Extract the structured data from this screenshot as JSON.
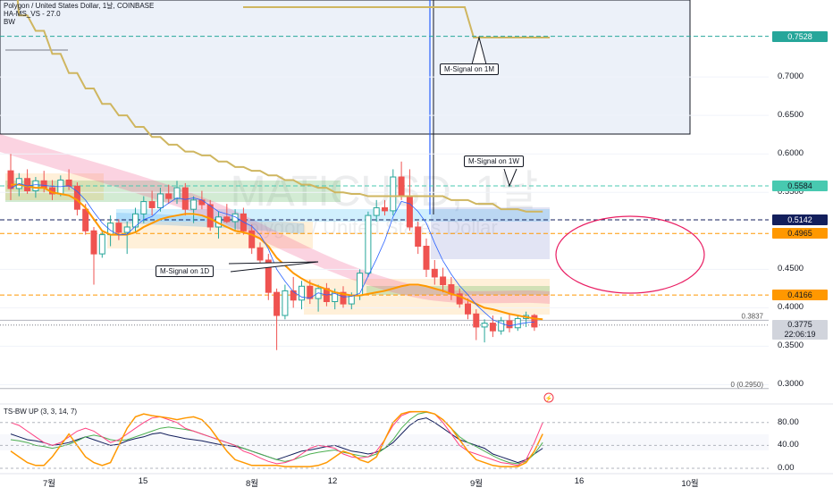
{
  "header": {
    "line1": "Polygon / United States Dollar, 1날, COINBASE",
    "line2": "HA-MS_VS - 27.0",
    "line3": "BW"
  },
  "watermark": {
    "symbol": "MATICUSD, 1날",
    "subtitle": "Polygon / United States Dollar"
  },
  "callouts": {
    "signal_1m": "M-Signal on 1M",
    "signal_1w": "M-Signal on 1W",
    "signal_1d": "M-Signal on 1D"
  },
  "oscillator": {
    "title": "TS-BW UP (3, 3, 14, 7)"
  },
  "chart_data": {
    "type": "candlestick",
    "price_axis": {
      "range": [
        0.275,
        0.8
      ],
      "ticks": [
        "0.7000",
        "0.6500",
        "0.6000",
        "0.5500",
        "0.4500",
        "0.4000",
        "0.3500",
        "0.3000"
      ]
    },
    "x_axis": {
      "labels": [
        "7월",
        "15",
        "8월",
        "12",
        "9월",
        "16",
        "10월"
      ]
    },
    "price_tags": [
      {
        "text": "0.7528",
        "value": 0.7528,
        "bg": "#26a69a",
        "fg": "#ffffff"
      },
      {
        "text": "0.5584",
        "value": 0.5584,
        "bg": "#48c9b0",
        "fg": "#131722"
      },
      {
        "text": "0.5142",
        "value": 0.5142,
        "bg": "#131f5c",
        "fg": "#ffffff"
      },
      {
        "text": "0.4965",
        "value": 0.4965,
        "bg": "#ff9800",
        "fg": "#131722"
      },
      {
        "text": "0.4166",
        "value": 0.4166,
        "bg": "#ff9800",
        "fg": "#131722"
      }
    ],
    "last_price": {
      "text": "0.3775",
      "countdown": "22:06:19",
      "value": 0.3775
    },
    "annotations": [
      {
        "text": "0.3837",
        "value": 0.3837
      },
      {
        "text": "0 (0.2950)",
        "value": 0.295
      }
    ],
    "oscillator_axis": {
      "ticks": [
        "80.00",
        "40.00",
        "0.00"
      ],
      "range": [
        0,
        100
      ]
    },
    "candles": [
      {
        "o": 0.578,
        "h": 0.6,
        "l": 0.54,
        "c": 0.555
      },
      {
        "o": 0.555,
        "h": 0.575,
        "l": 0.545,
        "c": 0.568
      },
      {
        "o": 0.568,
        "h": 0.58,
        "l": 0.548,
        "c": 0.552
      },
      {
        "o": 0.552,
        "h": 0.57,
        "l": 0.543,
        "c": 0.565
      },
      {
        "o": 0.565,
        "h": 0.578,
        "l": 0.55,
        "c": 0.556
      },
      {
        "o": 0.556,
        "h": 0.566,
        "l": 0.54,
        "c": 0.548
      },
      {
        "o": 0.548,
        "h": 0.572,
        "l": 0.545,
        "c": 0.566
      },
      {
        "o": 0.566,
        "h": 0.58,
        "l": 0.553,
        "c": 0.558
      },
      {
        "o": 0.558,
        "h": 0.563,
        "l": 0.52,
        "c": 0.528
      },
      {
        "o": 0.528,
        "h": 0.535,
        "l": 0.495,
        "c": 0.5
      },
      {
        "o": 0.5,
        "h": 0.505,
        "l": 0.43,
        "c": 0.47
      },
      {
        "o": 0.47,
        "h": 0.5,
        "l": 0.465,
        "c": 0.495
      },
      {
        "o": 0.495,
        "h": 0.52,
        "l": 0.48,
        "c": 0.51
      },
      {
        "o": 0.51,
        "h": 0.515,
        "l": 0.488,
        "c": 0.498
      },
      {
        "o": 0.498,
        "h": 0.512,
        "l": 0.47,
        "c": 0.505
      },
      {
        "o": 0.505,
        "h": 0.53,
        "l": 0.498,
        "c": 0.522
      },
      {
        "o": 0.522,
        "h": 0.545,
        "l": 0.51,
        "c": 0.538
      },
      {
        "o": 0.538,
        "h": 0.552,
        "l": 0.52,
        "c": 0.53
      },
      {
        "o": 0.53,
        "h": 0.556,
        "l": 0.525,
        "c": 0.548
      },
      {
        "o": 0.548,
        "h": 0.56,
        "l": 0.535,
        "c": 0.542
      },
      {
        "o": 0.542,
        "h": 0.565,
        "l": 0.535,
        "c": 0.556
      },
      {
        "o": 0.556,
        "h": 0.562,
        "l": 0.52,
        "c": 0.528
      },
      {
        "o": 0.528,
        "h": 0.545,
        "l": 0.51,
        "c": 0.54
      },
      {
        "o": 0.54,
        "h": 0.552,
        "l": 0.528,
        "c": 0.534
      },
      {
        "o": 0.534,
        "h": 0.54,
        "l": 0.5,
        "c": 0.505
      },
      {
        "o": 0.505,
        "h": 0.525,
        "l": 0.49,
        "c": 0.518
      },
      {
        "o": 0.518,
        "h": 0.535,
        "l": 0.51,
        "c": 0.512
      },
      {
        "o": 0.512,
        "h": 0.528,
        "l": 0.5,
        "c": 0.522
      },
      {
        "o": 0.522,
        "h": 0.53,
        "l": 0.495,
        "c": 0.5
      },
      {
        "o": 0.5,
        "h": 0.508,
        "l": 0.47,
        "c": 0.478
      },
      {
        "o": 0.478,
        "h": 0.485,
        "l": 0.455,
        "c": 0.462
      },
      {
        "o": 0.462,
        "h": 0.47,
        "l": 0.41,
        "c": 0.42
      },
      {
        "o": 0.42,
        "h": 0.425,
        "l": 0.345,
        "c": 0.39
      },
      {
        "o": 0.39,
        "h": 0.43,
        "l": 0.385,
        "c": 0.422
      },
      {
        "o": 0.422,
        "h": 0.44,
        "l": 0.4,
        "c": 0.41
      },
      {
        "o": 0.41,
        "h": 0.435,
        "l": 0.398,
        "c": 0.428
      },
      {
        "o": 0.428,
        "h": 0.436,
        "l": 0.405,
        "c": 0.412
      },
      {
        "o": 0.412,
        "h": 0.43,
        "l": 0.395,
        "c": 0.425
      },
      {
        "o": 0.425,
        "h": 0.432,
        "l": 0.402,
        "c": 0.408
      },
      {
        "o": 0.408,
        "h": 0.425,
        "l": 0.398,
        "c": 0.42
      },
      {
        "o": 0.42,
        "h": 0.428,
        "l": 0.4,
        "c": 0.405
      },
      {
        "o": 0.405,
        "h": 0.42,
        "l": 0.398,
        "c": 0.416
      },
      {
        "o": 0.416,
        "h": 0.45,
        "l": 0.41,
        "c": 0.445
      },
      {
        "o": 0.445,
        "h": 0.525,
        "l": 0.44,
        "c": 0.52
      },
      {
        "o": 0.52,
        "h": 0.54,
        "l": 0.512,
        "c": 0.53
      },
      {
        "o": 0.53,
        "h": 0.54,
        "l": 0.52,
        "c": 0.526
      },
      {
        "o": 0.526,
        "h": 0.58,
        "l": 0.52,
        "c": 0.57
      },
      {
        "o": 0.57,
        "h": 0.59,
        "l": 0.54,
        "c": 0.545
      },
      {
        "o": 0.545,
        "h": 0.58,
        "l": 0.5,
        "c": 0.505
      },
      {
        "o": 0.505,
        "h": 0.512,
        "l": 0.47,
        "c": 0.48
      },
      {
        "o": 0.48,
        "h": 0.49,
        "l": 0.44,
        "c": 0.45
      },
      {
        "o": 0.45,
        "h": 0.462,
        "l": 0.43,
        "c": 0.44
      },
      {
        "o": 0.44,
        "h": 0.452,
        "l": 0.42,
        "c": 0.43
      },
      {
        "o": 0.43,
        "h": 0.44,
        "l": 0.41,
        "c": 0.418
      },
      {
        "o": 0.418,
        "h": 0.425,
        "l": 0.4,
        "c": 0.405
      },
      {
        "o": 0.405,
        "h": 0.412,
        "l": 0.385,
        "c": 0.392
      },
      {
        "o": 0.392,
        "h": 0.398,
        "l": 0.358,
        "c": 0.375
      },
      {
        "o": 0.375,
        "h": 0.385,
        "l": 0.355,
        "c": 0.38
      },
      {
        "o": 0.38,
        "h": 0.39,
        "l": 0.362,
        "c": 0.37
      },
      {
        "o": 0.37,
        "h": 0.388,
        "l": 0.365,
        "c": 0.383
      },
      {
        "o": 0.383,
        "h": 0.392,
        "l": 0.368,
        "c": 0.374
      },
      {
        "o": 0.374,
        "h": 0.39,
        "l": 0.37,
        "c": 0.386
      },
      {
        "o": 0.386,
        "h": 0.395,
        "l": 0.375,
        "c": 0.39
      },
      {
        "o": 0.39,
        "h": 0.392,
        "l": 0.37,
        "c": 0.375
      }
    ],
    "signal_1m": [
      0.9,
      0.78,
      0.78,
      0.76,
      0.76,
      0.73,
      0.73,
      0.705,
      0.705,
      0.685,
      0.685,
      0.665,
      0.665,
      0.65,
      0.65,
      0.635,
      0.635,
      0.622,
      0.622,
      0.612,
      0.612,
      0.603,
      0.603,
      0.598,
      0.598,
      0.59,
      0.59,
      0.583,
      0.583,
      0.578,
      0.578,
      0.572,
      0.572,
      0.566,
      0.566,
      0.56,
      0.56,
      0.556,
      0.556,
      0.55,
      0.55,
      0.548,
      0.548,
      0.545,
      0.545,
      0.545,
      0.545,
      0.545,
      0.545,
      0.545,
      0.545,
      0.545,
      0.545,
      0.54,
      0.54,
      0.54,
      0.535,
      0.535,
      0.535,
      0.528,
      0.528,
      0.528,
      0.525,
      0.525,
      0.525
    ],
    "signal_1d": [
      0.56,
      0.56,
      0.558,
      0.556,
      0.556,
      0.55,
      0.548,
      0.546,
      0.54,
      0.53,
      0.515,
      0.5,
      0.495,
      0.495,
      0.495,
      0.498,
      0.505,
      0.51,
      0.515,
      0.518,
      0.52,
      0.522,
      0.522,
      0.52,
      0.516,
      0.51,
      0.505,
      0.5,
      0.498,
      0.495,
      0.49,
      0.48,
      0.465,
      0.455,
      0.445,
      0.438,
      0.432,
      0.428,
      0.424,
      0.42,
      0.418,
      0.416,
      0.416,
      0.418,
      0.42,
      0.422,
      0.425,
      0.428,
      0.43,
      0.43,
      0.428,
      0.425,
      0.422,
      0.418,
      0.415,
      0.41,
      0.405,
      0.4,
      0.398,
      0.395,
      0.392,
      0.39,
      0.388,
      0.386,
      0.385
    ],
    "oscillator": {
      "blue": [
        60,
        55,
        50,
        48,
        45,
        40,
        42,
        45,
        50,
        55,
        50,
        45,
        40,
        42,
        48,
        52,
        55,
        60,
        62,
        58,
        55,
        52,
        50,
        48,
        45,
        42,
        40,
        38,
        35,
        30,
        25,
        20,
        15,
        20,
        25,
        30,
        32,
        35,
        38,
        40,
        35,
        30,
        28,
        25,
        28,
        35,
        45,
        60,
        75,
        85,
        88,
        80,
        70,
        60,
        50,
        45,
        40,
        35,
        25,
        20,
        15,
        10,
        15,
        25,
        35
      ],
      "green": [
        50,
        48,
        45,
        40,
        38,
        35,
        38,
        42,
        48,
        55,
        58,
        55,
        50,
        48,
        50,
        55,
        60,
        65,
        70,
        72,
        70,
        68,
        65,
        60,
        55,
        50,
        45,
        40,
        35,
        30,
        25,
        20,
        15,
        12,
        15,
        20,
        25,
        28,
        30,
        32,
        28,
        25,
        22,
        20,
        25,
        35,
        50,
        70,
        85,
        95,
        98,
        95,
        85,
        70,
        55,
        45,
        38,
        30,
        22,
        15,
        10,
        8,
        12,
        25,
        45
      ],
      "red": [
        80,
        75,
        65,
        55,
        45,
        40,
        45,
        55,
        65,
        70,
        65,
        55,
        45,
        50,
        60,
        70,
        80,
        88,
        90,
        85,
        80,
        70,
        65,
        60,
        55,
        50,
        45,
        40,
        30,
        25,
        18,
        12,
        8,
        10,
        15,
        25,
        35,
        40,
        38,
        35,
        25,
        20,
        18,
        20,
        30,
        50,
        75,
        92,
        98,
        99,
        99,
        95,
        80,
        60,
        40,
        30,
        25,
        20,
        15,
        10,
        8,
        5,
        15,
        45,
        80
      ],
      "orange": [
        30,
        20,
        10,
        5,
        5,
        20,
        40,
        60,
        40,
        20,
        10,
        5,
        10,
        40,
        70,
        90,
        95,
        92,
        90,
        88,
        85,
        88,
        90,
        85,
        70,
        50,
        30,
        15,
        10,
        5,
        5,
        5,
        5,
        3,
        3,
        3,
        3,
        5,
        10,
        20,
        30,
        25,
        15,
        10,
        20,
        50,
        80,
        95,
        99,
        99,
        99,
        95,
        85,
        70,
        50,
        30,
        15,
        10,
        5,
        3,
        3,
        3,
        10,
        30,
        60
      ]
    }
  }
}
